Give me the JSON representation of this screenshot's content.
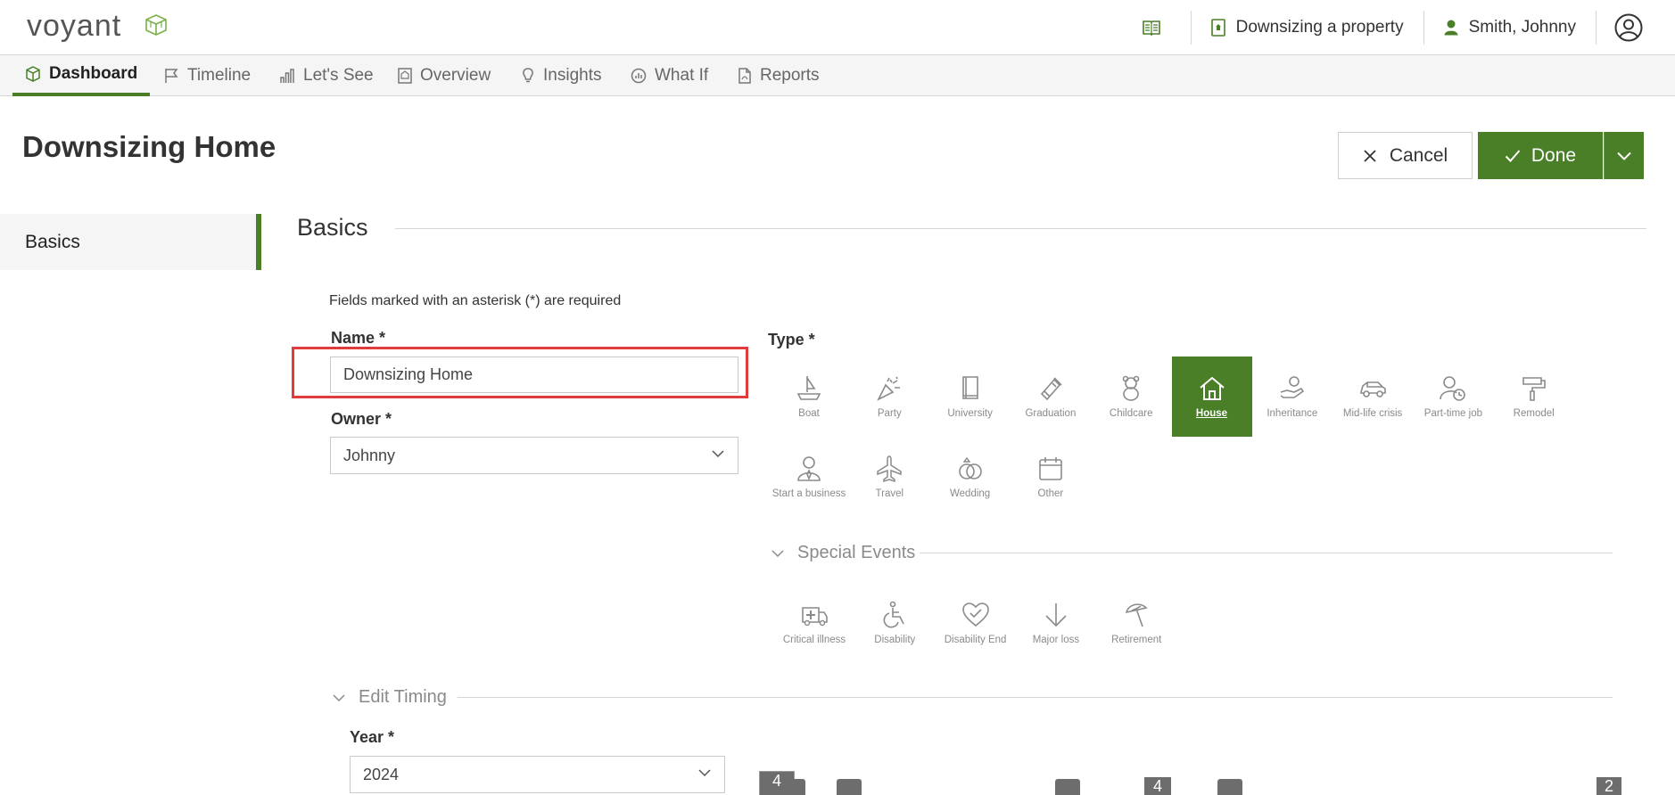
{
  "brand": {
    "name": "voyant",
    "accent": "#4a7f27"
  },
  "topbar": {
    "book_icon": "book-icon",
    "plan_label": "Downsizing a property",
    "user_label": "Smith, Johnny"
  },
  "tabs": [
    {
      "label": "Dashboard",
      "icon": "cube-icon",
      "active": true
    },
    {
      "label": "Timeline",
      "icon": "flag-icon"
    },
    {
      "label": "Let's See",
      "icon": "bar-chart-icon"
    },
    {
      "label": "Overview",
      "icon": "document-icon"
    },
    {
      "label": "Insights",
      "icon": "lightbulb-icon"
    },
    {
      "label": "What If",
      "icon": "gauge-icon"
    },
    {
      "label": "Reports",
      "icon": "pdf-icon"
    }
  ],
  "page": {
    "title": "Downsizing Home",
    "cancel_label": "Cancel",
    "done_label": "Done"
  },
  "sidenav": {
    "basics_label": "Basics"
  },
  "section": {
    "title": "Basics",
    "required_note": "Fields marked with an asterisk (*) are required"
  },
  "form": {
    "name_label": "Name *",
    "name_value": "Downsizing Home",
    "owner_label": "Owner *",
    "owner_value": "Johnny",
    "type_label": "Type *",
    "types": [
      {
        "label": "Boat",
        "icon": "boat-icon"
      },
      {
        "label": "Party",
        "icon": "party-icon"
      },
      {
        "label": "University",
        "icon": "book-icon"
      },
      {
        "label": "Graduation",
        "icon": "diploma-icon"
      },
      {
        "label": "Childcare",
        "icon": "teddy-bear-icon"
      },
      {
        "label": "House",
        "icon": "house-icon",
        "selected": true
      },
      {
        "label": "Inheritance",
        "icon": "hand-money-icon"
      },
      {
        "label": "Mid-life crisis",
        "icon": "car-icon"
      },
      {
        "label": "Part-time job",
        "icon": "person-clock-icon"
      },
      {
        "label": "Remodel",
        "icon": "paint-roller-icon"
      },
      {
        "label": "Start a business",
        "icon": "businessperson-icon"
      },
      {
        "label": "Travel",
        "icon": "plane-icon"
      },
      {
        "label": "Wedding",
        "icon": "rings-icon"
      },
      {
        "label": "Other",
        "icon": "calendar-icon"
      }
    ],
    "special_events_label": "Special Events",
    "special_events": [
      {
        "label": "Critical illness",
        "icon": "ambulance-icon"
      },
      {
        "label": "Disability",
        "icon": "wheelchair-icon"
      },
      {
        "label": "Disability End",
        "icon": "heart-check-icon"
      },
      {
        "label": "Major loss",
        "icon": "arrow-down-icon"
      },
      {
        "label": "Retirement",
        "icon": "beach-umbrella-icon"
      }
    ],
    "edit_timing_label": "Edit Timing",
    "year_label": "Year *",
    "year_value": "2024"
  },
  "timeline_markers": [
    "4",
    "4",
    "2"
  ]
}
